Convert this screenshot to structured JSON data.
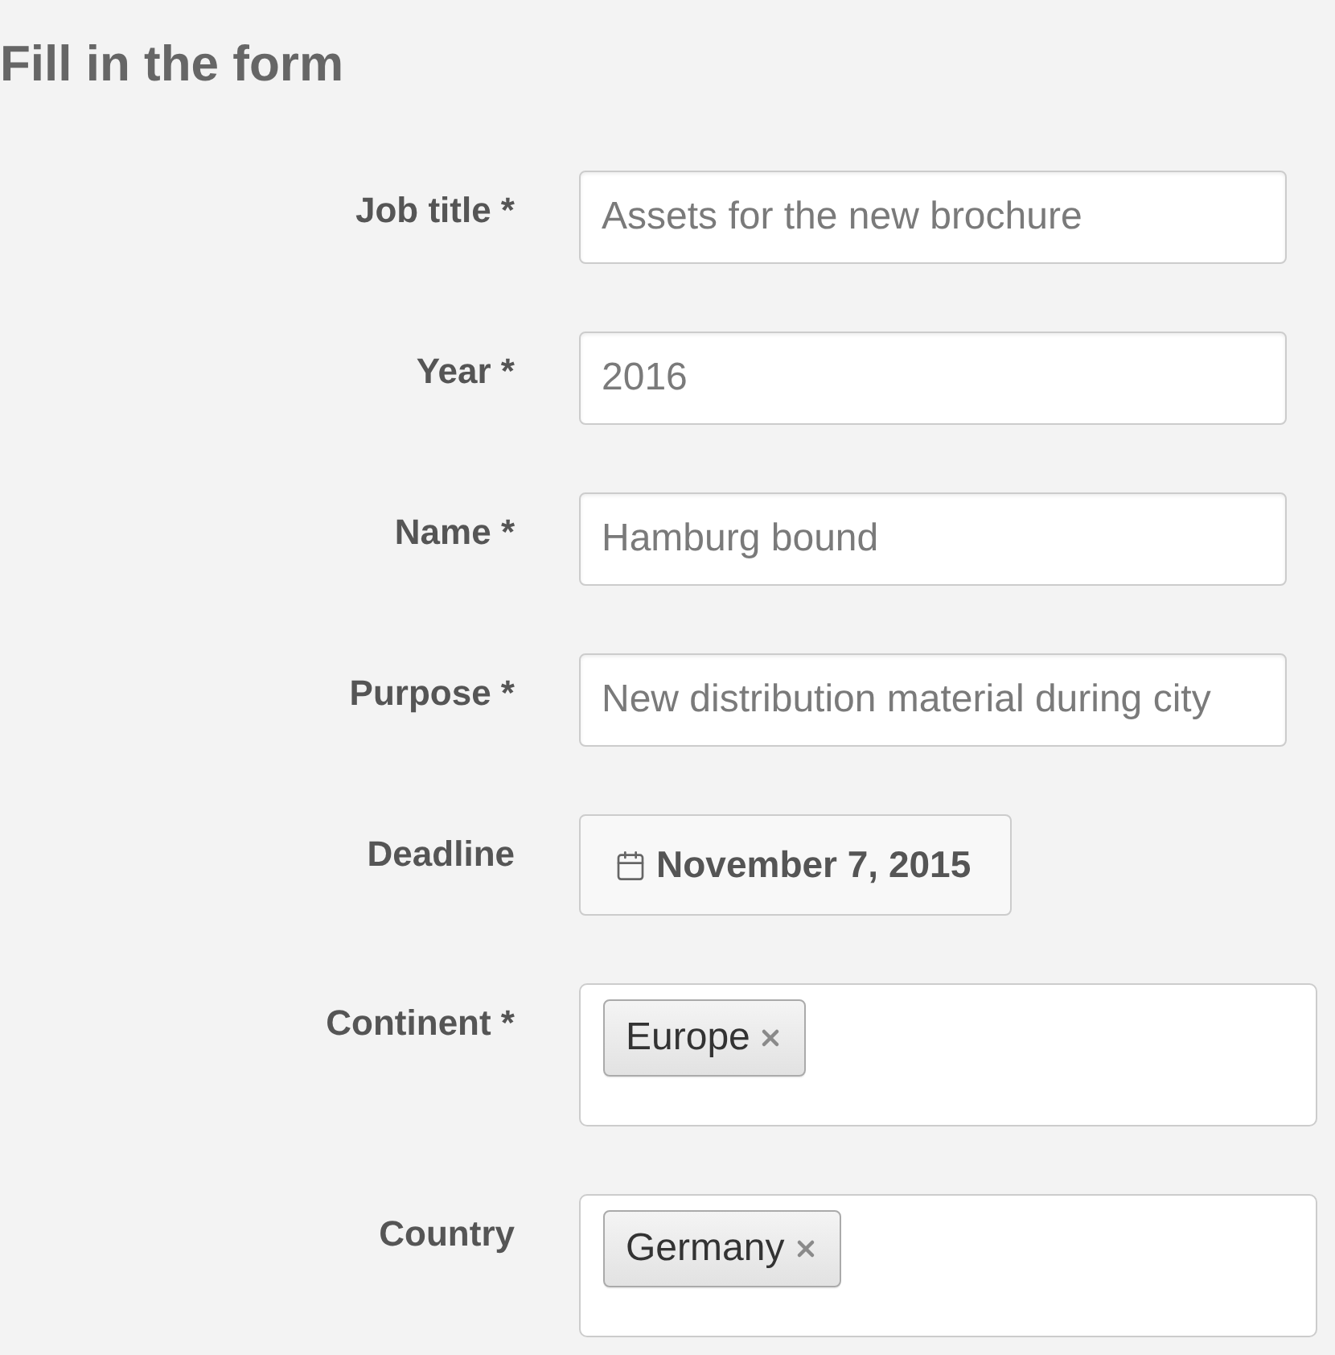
{
  "heading": "Fill in the form",
  "fields": [
    {
      "kind": "text",
      "label": "Job title *",
      "value": "Assets for the new brochure"
    },
    {
      "kind": "text",
      "label": "Year *",
      "value": "2016"
    },
    {
      "kind": "text",
      "label": "Name *",
      "value": "Hamburg bound"
    },
    {
      "kind": "text",
      "label": "Purpose *",
      "value": "New distribution material during city"
    },
    {
      "kind": "date",
      "label": "Deadline",
      "value": "November 7, 2015"
    },
    {
      "kind": "tags",
      "label": "Continent *",
      "tags": [
        "Europe"
      ]
    },
    {
      "kind": "tags",
      "label": "Country",
      "tags": [
        "Germany"
      ]
    }
  ]
}
